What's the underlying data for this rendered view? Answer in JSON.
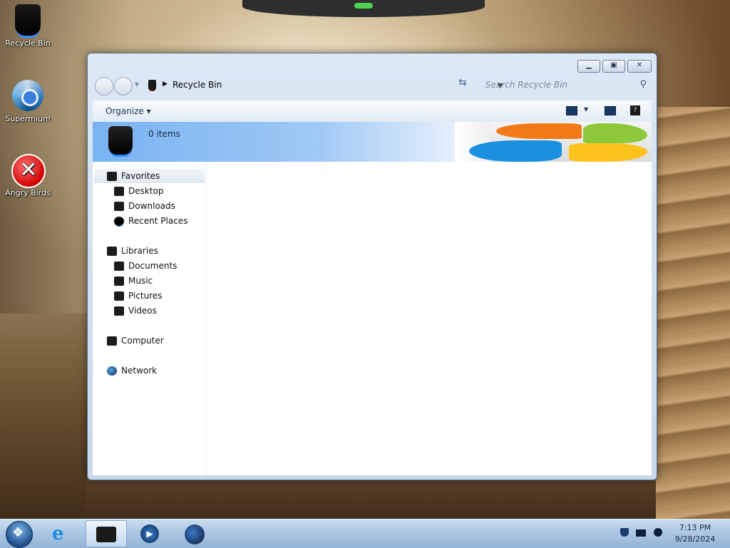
{
  "desktop": {
    "icons": [
      {
        "label": "Recycle Bin"
      },
      {
        "label": "Supermium"
      },
      {
        "label": "Angry Birds"
      }
    ]
  },
  "window": {
    "address": {
      "location": "Recycle Bin"
    },
    "search": {
      "placeholder": "Search Recycle Bin"
    },
    "toolbar": {
      "organize_label": "Organize"
    },
    "info": {
      "item_count": "0 items"
    },
    "nav": {
      "favorites": "Favorites",
      "desktop": "Desktop",
      "downloads": "Downloads",
      "recent_places": "Recent Places",
      "libraries": "Libraries",
      "documents": "Documents",
      "music": "Music",
      "pictures": "Pictures",
      "videos": "Videos",
      "computer": "Computer",
      "network": "Network"
    }
  },
  "taskbar": {
    "clock": {
      "time": "7:13 PM",
      "date": "9/28/2024"
    }
  },
  "colors": {
    "window_frame": "#c7d9ec",
    "info_bar": "#79b3f2",
    "taskbar": "#a9c6e3"
  }
}
